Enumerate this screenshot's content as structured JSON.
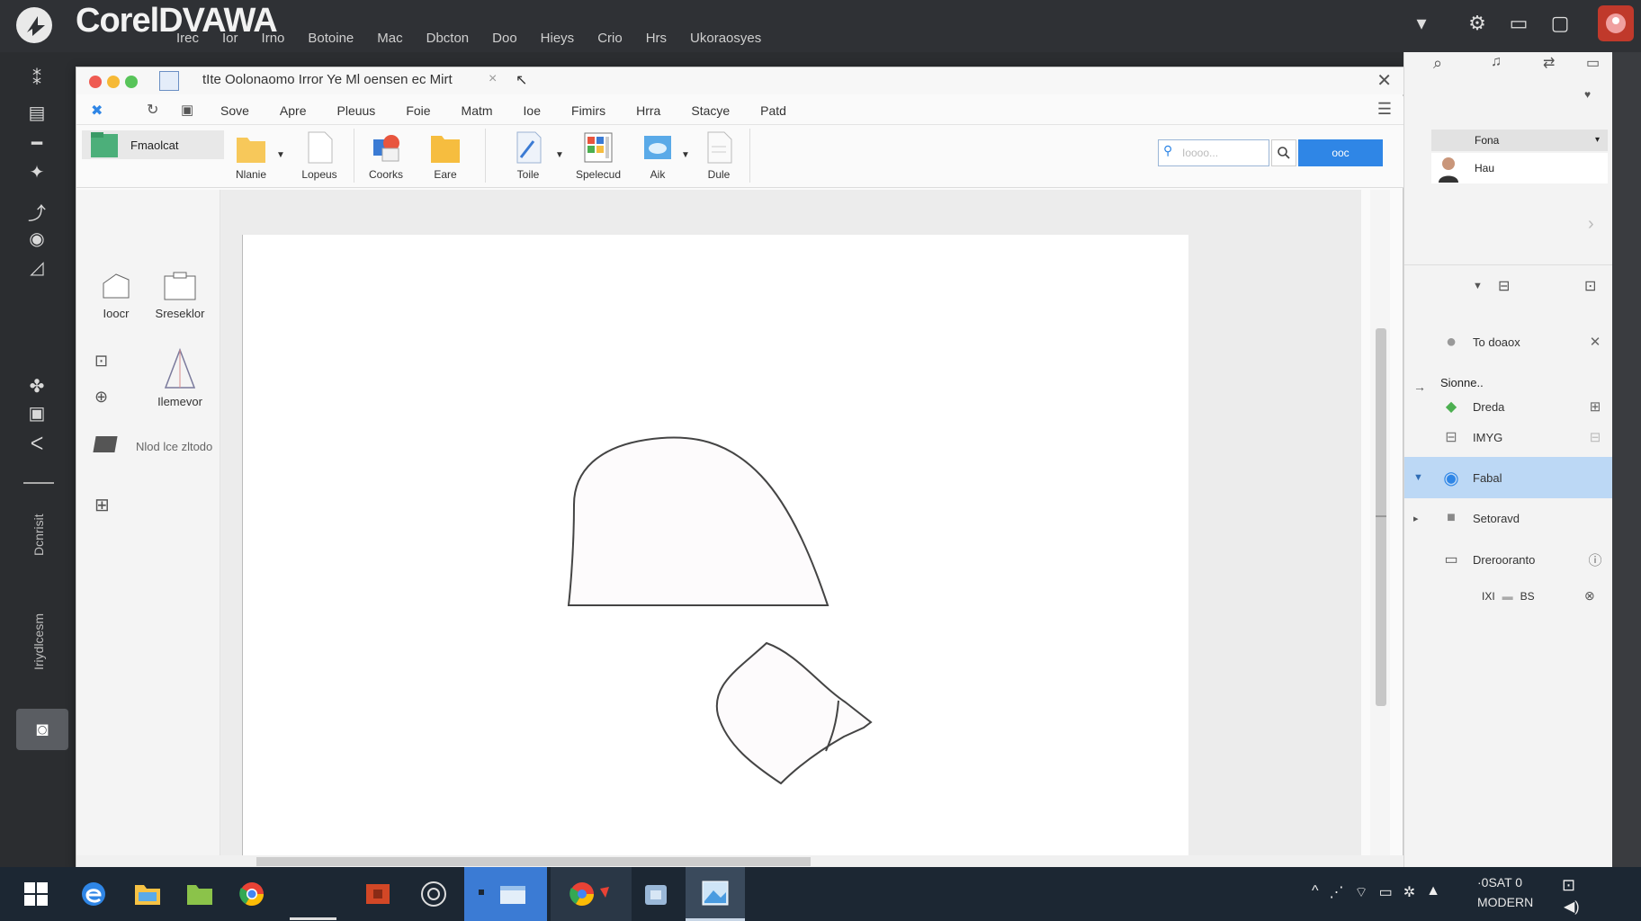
{
  "app": {
    "title": "CorelDVAWA",
    "menu": [
      "Irec",
      "Ior",
      "Irno",
      "Botoine",
      "Mac",
      "Dbcton",
      "Doo",
      "Hieys",
      "Crio",
      "Hrs",
      "Ukoraosyes"
    ]
  },
  "left_toolbar": {
    "vertical_labels": [
      "Dcnrisit",
      "Iriydlcesm"
    ]
  },
  "window": {
    "title": "tIte Oolonaomo Irror Ye Ml oensen ec Mirt",
    "menu": [
      "Sove",
      "Apre",
      "Pleuus",
      "Foie",
      "Matm",
      "Ioe",
      "Fimirs",
      "Hrra",
      "Stacye",
      "Patd"
    ]
  },
  "ribbon": {
    "buttons": [
      {
        "label": "Nlanie",
        "icon": "folder-icon"
      },
      {
        "label": "Lopeus",
        "icon": "document-icon"
      },
      {
        "label": "Coorks",
        "icon": "shapes-icon"
      },
      {
        "label": "Eare",
        "icon": "folder-icon"
      },
      {
        "label": "Toile",
        "icon": "pen-tool-icon"
      },
      {
        "label": "Spelecud",
        "icon": "grid-image-icon"
      },
      {
        "label": "Aik",
        "icon": "cloud-image-icon"
      },
      {
        "label": "Dule",
        "icon": "page-icon"
      }
    ],
    "search_placeholder": "Ioooo...",
    "search_button": "ooc"
  },
  "tool_panel": {
    "top_item": "Fmaolcat",
    "tools": [
      "Ioocr",
      "Sreseklor",
      "Ilemevor",
      "Nlod lce zltodo"
    ]
  },
  "right_panel": {
    "header": "Fona",
    "profile_name": "Hau",
    "rows": [
      {
        "label": "To doaox",
        "icon": "circle-icon"
      },
      {
        "label": "Sionne..",
        "icon": ""
      },
      {
        "label": "Dreda",
        "icon": "chat-icon"
      },
      {
        "label": "IMYG",
        "icon": "image-icon"
      },
      {
        "label": "Fabal",
        "icon": "globe-icon"
      },
      {
        "label": "Setoravd",
        "icon": "folder-icon"
      },
      {
        "label": "Drerooranto",
        "icon": "rectangle-icon"
      },
      {
        "label": "IXI",
        "value": "BS",
        "icon": ""
      }
    ]
  },
  "taskbar": {
    "clock_line1": "·0SAT 0",
    "clock_line2": "MODERN"
  },
  "colors": {
    "accent": "#2f86e6",
    "selected_row": "#bcd8f5",
    "app_bar": "#2f3135",
    "taskbar": "#1c2733"
  }
}
